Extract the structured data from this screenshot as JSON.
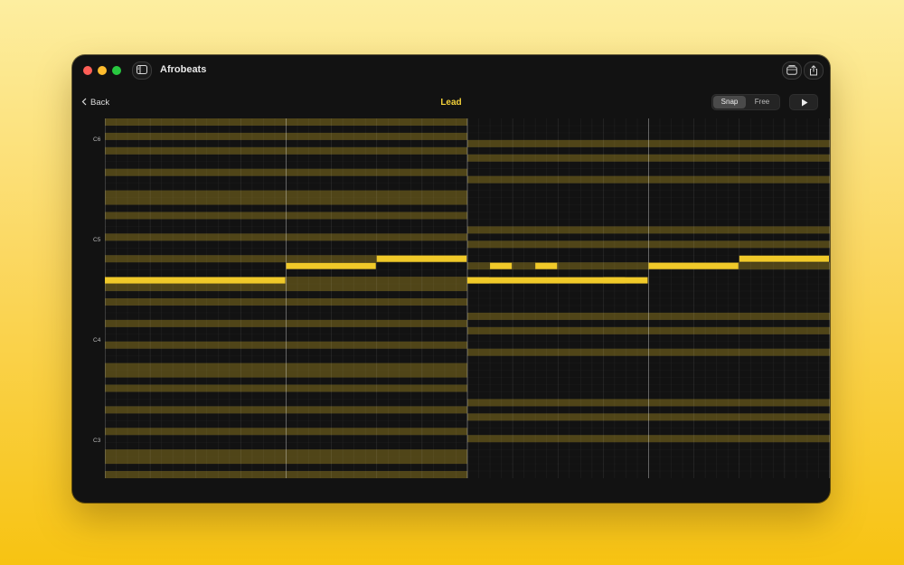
{
  "window": {
    "app_title": "Afrobeats"
  },
  "toolbar": {
    "back_label": "Back",
    "track_title": "Lead",
    "snap_options": [
      "Snap",
      "Free"
    ],
    "snap_selected": "Snap"
  },
  "piano_roll": {
    "key_labels": [
      "C6",
      "C5",
      "C4",
      "C3"
    ],
    "accent": "#f0c929",
    "background": "#121212",
    "bars_visible": 8,
    "highlighted_row_indices_left": [
      0,
      2,
      4,
      7,
      10,
      11,
      13,
      16,
      19,
      22,
      23,
      25,
      28,
      31,
      34,
      35,
      37,
      40,
      43,
      46,
      47,
      49
    ],
    "highlighted_row_indices_right": [
      3,
      5,
      8,
      15,
      17,
      20,
      27,
      29,
      32,
      39,
      41,
      44
    ],
    "notes": [
      {
        "bar": 0,
        "start": 0.0,
        "length": 1.0,
        "row": 22
      },
      {
        "bar": 0,
        "start": 1.0,
        "length": 0.5,
        "row": 20
      },
      {
        "bar": 0,
        "start": 1.5,
        "length": 0.5,
        "row": 19
      },
      {
        "bar": 0,
        "start": 2.0,
        "length": 0.125,
        "row": 22
      },
      {
        "bar": 0,
        "start": 2.125,
        "length": 0.125,
        "row": 20
      },
      {
        "bar": 0,
        "start": 2.375,
        "length": 0.125,
        "row": 20
      },
      {
        "bar": 0,
        "start": 2.75,
        "length": 0.125,
        "row": 22
      },
      {
        "bar": 1,
        "start": 0.0,
        "length": 1.0,
        "row": 22
      },
      {
        "bar": 1,
        "start": 1.0,
        "length": 0.5,
        "row": 20
      },
      {
        "bar": 1,
        "start": 1.5,
        "length": 0.5,
        "row": 19
      },
      {
        "bar": 1,
        "start": 2.0,
        "length": 0.125,
        "row": 22
      },
      {
        "bar": 1,
        "start": 2.125,
        "length": 0.125,
        "row": 20
      },
      {
        "bar": 1,
        "start": 2.375,
        "length": 0.125,
        "row": 20
      },
      {
        "bar": 1,
        "start": 2.75,
        "length": 0.125,
        "row": 22
      }
    ]
  }
}
